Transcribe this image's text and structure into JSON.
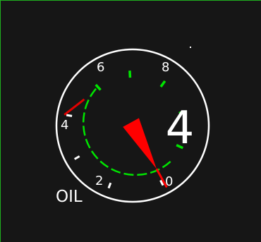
{
  "gauge": {
    "label": "OIL",
    "digital_readout": "4",
    "scale_labels": [
      "0",
      "2",
      "4",
      "6",
      "8"
    ],
    "reading": 0.05,
    "normal_range": [
      0.5,
      5
    ],
    "red_zone": [
      5.5,
      6.0
    ],
    "colors": {
      "background": "#161616",
      "frame": "#1fb01f",
      "bezel": "#ffffff",
      "normal_arc": "#00e600",
      "red_zone": "#e00000",
      "needle": "#ff0000",
      "text": "#ffffff"
    },
    "icons": {
      "needle": "pointer-triangle",
      "bezel": "circle-outline"
    }
  }
}
